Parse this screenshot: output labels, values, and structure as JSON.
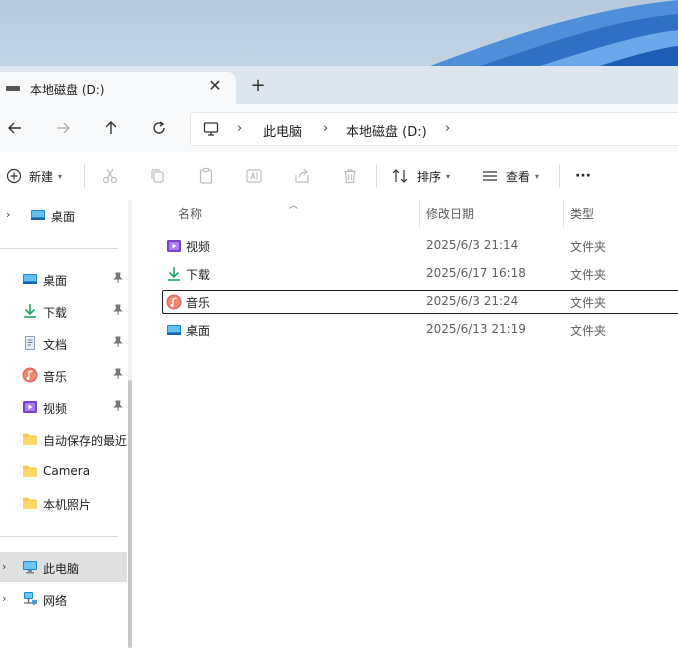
{
  "tab": {
    "title": "本地磁盘 (D:)",
    "close": "✕",
    "new": "+"
  },
  "breadcrumb": [
    "此电脑",
    "本地磁盘 (D:)"
  ],
  "toolbar": {
    "new_label": "新建",
    "sort_label": "排序",
    "view_label": "查看",
    "more_label": "···"
  },
  "sidebar": {
    "top": {
      "label": "桌面",
      "icon": "desktop-icon"
    },
    "quick_access": [
      {
        "label": "桌面",
        "icon": "desktop-icon",
        "pinned": true
      },
      {
        "label": "下载",
        "icon": "download-icon",
        "pinned": true
      },
      {
        "label": "文档",
        "icon": "document-icon",
        "pinned": true
      },
      {
        "label": "音乐",
        "icon": "music-icon",
        "pinned": true
      },
      {
        "label": "视频",
        "icon": "video-icon",
        "pinned": true
      },
      {
        "label": "自动保存的最近",
        "icon": "folder-icon",
        "pinned": false
      },
      {
        "label": "Camera",
        "icon": "folder-icon",
        "pinned": false
      },
      {
        "label": "本机照片",
        "icon": "folder-icon",
        "pinned": false
      }
    ],
    "bottom": [
      {
        "label": "此电脑",
        "icon": "this-pc-icon",
        "selected": true
      },
      {
        "label": "网络",
        "icon": "network-icon",
        "selected": false
      }
    ]
  },
  "columns": {
    "name": "名称",
    "date": "修改日期",
    "type": "类型"
  },
  "files": [
    {
      "name": "视频",
      "date": "2025/6/3 21:14",
      "type": "文件夹",
      "icon": "video-icon"
    },
    {
      "name": "下载",
      "date": "2025/6/17 16:18",
      "type": "文件夹",
      "icon": "download-icon"
    },
    {
      "name": "音乐",
      "date": "2025/6/3 21:24",
      "type": "文件夹",
      "icon": "music-icon"
    },
    {
      "name": "桌面",
      "date": "2025/6/13 21:19",
      "type": "文件夹",
      "icon": "desktop-icon"
    }
  ],
  "colors": {
    "accent": "#0067c0",
    "folder": "#f8c94d",
    "download": "#21a366",
    "video": "#7a3fd0",
    "music": "#e0676a"
  }
}
